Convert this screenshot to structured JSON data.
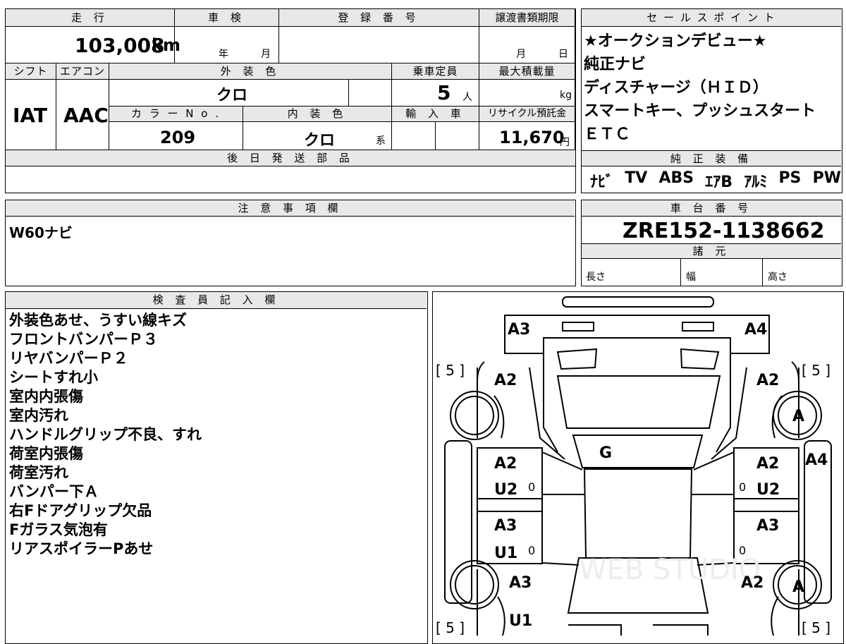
{
  "headers": {
    "mileage": "走 行",
    "shaken": "車 検",
    "registration_no": "登 録 番 号",
    "transfer_deadline": "譲渡書類期限",
    "sales_points": "セ ー ル ス ポ イ ン ト",
    "shift": "シフト",
    "aircon": "エアコン",
    "exterior_color": "外 装 色",
    "capacity": "乗車定員",
    "max_load": "最大積載量",
    "color_no": "カ ラ ー N o .",
    "interior_color": "内 装 色",
    "import": "輸 入 車",
    "recycle": "リサイクル預託金",
    "later_parts": "後 日 発 送 部 品",
    "genuine_equipment": "純 正 装 備",
    "notes": "注 意 事 項 欄",
    "chassis_no": "車 台 番 号",
    "specs": "諸 元",
    "inspector": "検 査 員 記 入 欄"
  },
  "vehicle": {
    "mileage": "103,008",
    "mileage_unit": "km",
    "shaken_year": "年",
    "shaken_month": "月",
    "deadline_month": "月",
    "deadline_day": "日",
    "shift": "IAT",
    "aircon": "AAC",
    "exterior_color": "クロ",
    "capacity": "5",
    "capacity_unit": "人",
    "max_load_unit": "kg",
    "color_no": "209",
    "interior_color": "クロ",
    "interior_suffix": "系",
    "recycle_fee": "11,670",
    "recycle_unit": "円",
    "chassis_no": "ZRE152-1138662",
    "spec_length": "長さ",
    "spec_width": "幅",
    "spec_height": "高さ"
  },
  "sales_points": [
    "★オークションデビュー★",
    "純正ナビ",
    "ディスチャージ（ＨＩＤ）",
    "スマートキー、プッシュスタート",
    "ＥＴＣ"
  ],
  "genuine_equipment": [
    "ﾅﾋﾞ",
    "TV",
    "ABS",
    "ｴｱB",
    "ｱﾙﾐ",
    "PS",
    "PW"
  ],
  "notes_text": "W60ナビ",
  "inspector_notes": [
    "外装色あせ、うすい線キズ",
    "フロントバンパーＰ３",
    "リヤバンパーＰ２",
    "シートすれ小",
    "室内内張傷",
    "室内汚れ",
    "ハンドルグリップ不良、すれ",
    "荷室内張傷",
    "荷室汚れ",
    "バンパー下Ａ",
    "右Fドアグリップ欠品",
    "Fガラス気泡有",
    "リアスポイラーPあせ"
  ],
  "diagram": {
    "tire_left": "[ 5 ]",
    "tire_right": "[ 5 ]",
    "front_left": "A3",
    "front_right": "A4",
    "fender_left": "A2",
    "fender_right": "A2",
    "wheel_front_right": "A",
    "windshield": "G",
    "pillar_right": "A4",
    "front_door_left_1": "A2",
    "front_door_left_2": "U2",
    "front_door_right_1": "A2",
    "front_door_right_2": "U2",
    "rear_door_left_1": "A3",
    "rear_door_left_2": "U1",
    "rear_door_right_1": "A3",
    "quarter_left": "A3",
    "quarter_right": "A2",
    "wheel_rear_right": "A",
    "rear_left": "U1",
    "zero": "0",
    "watermark": "WEB STUDIO"
  }
}
